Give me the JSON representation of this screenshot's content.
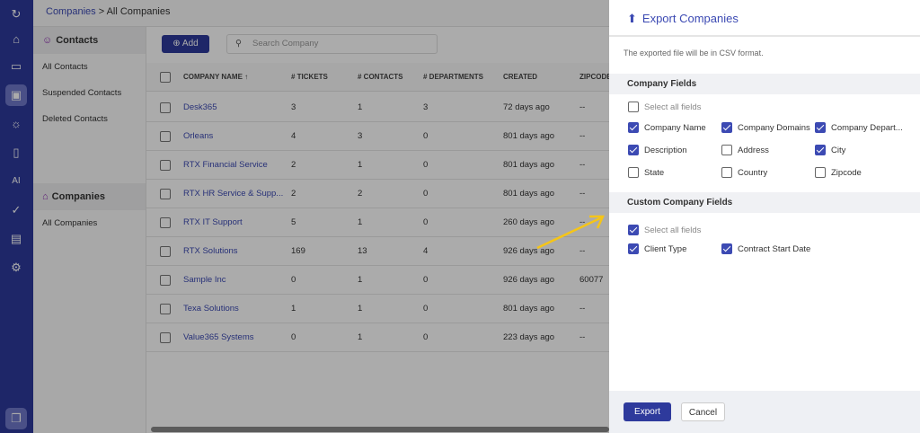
{
  "breadcrumb": {
    "parent": "Companies",
    "separator": " > ",
    "current": "All Companies"
  },
  "rail": [
    "logo-icon",
    "home-icon",
    "ticket-icon",
    "contacts-icon",
    "dashboard-icon",
    "knowledge-base-icon",
    "ai-icon",
    "tasks-icon",
    "reports-icon",
    "settings-icon",
    "chat-icon"
  ],
  "left_panel": {
    "contacts_header": "Contacts",
    "contacts_items": [
      "All Contacts",
      "Suspended Contacts",
      "Deleted Contacts"
    ],
    "companies_header": "Companies",
    "companies_items": [
      "All Companies"
    ]
  },
  "toolbar": {
    "add_label": "Add",
    "search_placeholder": "Search Company"
  },
  "table": {
    "headers": [
      "COMPANY NAME",
      "# TICKETS",
      "# CONTACTS",
      "# DEPARTMENTS",
      "CREATED",
      "ZIPCODE"
    ],
    "rows": [
      [
        "Desk365",
        "3",
        "1",
        "3",
        "72 days ago",
        "--"
      ],
      [
        "Orleans",
        "4",
        "3",
        "0",
        "801 days ago",
        "--"
      ],
      [
        "RTX Financial Service",
        "2",
        "1",
        "0",
        "801 days ago",
        "--"
      ],
      [
        "RTX HR Service & Supp...",
        "2",
        "2",
        "0",
        "801 days ago",
        "--"
      ],
      [
        "RTX IT Support",
        "5",
        "1",
        "0",
        "260 days ago",
        "--"
      ],
      [
        "RTX Solutions",
        "169",
        "13",
        "4",
        "926 days ago",
        "--"
      ],
      [
        "Sample Inc",
        "0",
        "1",
        "0",
        "926 days ago",
        "60077"
      ],
      [
        "Texa Solutions",
        "1",
        "1",
        "0",
        "801 days ago",
        "--"
      ],
      [
        "Value365 Systems",
        "0",
        "1",
        "0",
        "223 days ago",
        "--"
      ]
    ]
  },
  "export": {
    "title": "Export Companies",
    "note": "The exported file will be in CSV format.",
    "company_fields_title": "Company Fields",
    "company_select_all": {
      "label": "Select all fields",
      "checked": false
    },
    "company_fields": [
      {
        "label": "Company Name",
        "checked": true
      },
      {
        "label": "Company Domains",
        "checked": true
      },
      {
        "label": "Company Depart...",
        "checked": true
      },
      {
        "label": "Description",
        "checked": true
      },
      {
        "label": "Address",
        "checked": false
      },
      {
        "label": "City",
        "checked": true
      },
      {
        "label": "State",
        "checked": false
      },
      {
        "label": "Country",
        "checked": false
      },
      {
        "label": "Zipcode",
        "checked": false
      }
    ],
    "custom_fields_title": "Custom Company Fields",
    "custom_select_all": {
      "label": "Select all fields",
      "checked": true
    },
    "custom_fields": [
      {
        "label": "Client Type",
        "checked": true
      },
      {
        "label": "Contract Start Date",
        "checked": true
      }
    ],
    "export_label": "Export",
    "cancel_label": "Cancel"
  },
  "colors": {
    "brand": "#2e3a9c",
    "accent": "#3c4ab3",
    "annotation_arrow": "#f5c518"
  }
}
